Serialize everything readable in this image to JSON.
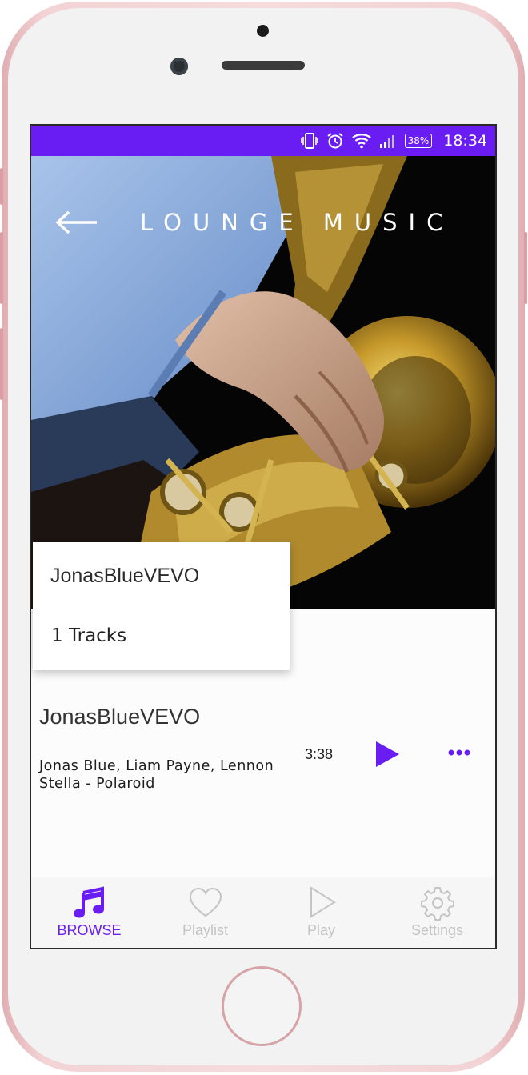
{
  "status_bar": {
    "battery": "38%",
    "time": "18:34",
    "icons": [
      "vibrate-icon",
      "alarm-icon",
      "wifi-icon",
      "signal-icon",
      "battery-icon"
    ]
  },
  "header": {
    "title": "LOUNGE MUSIC",
    "back_icon": "arrow-left-icon"
  },
  "album": {
    "name": "JonasBlueVEVO",
    "tracks_label": "1 Tracks"
  },
  "track": {
    "title": "JonasBlueVEVO",
    "artist": "Jonas Blue, Liam Payne, Lennon Stella - Polaroid",
    "duration": "3:38",
    "play_icon": "play-icon",
    "more_icon": "more-dots-icon"
  },
  "bottom_nav": {
    "items": [
      {
        "label": "BROWSE",
        "icon": "music-note-icon",
        "active": true
      },
      {
        "label": "Playlist",
        "icon": "heart-icon",
        "active": false
      },
      {
        "label": "Play",
        "icon": "play-outline-icon",
        "active": false
      },
      {
        "label": "Settings",
        "icon": "gear-icon",
        "active": false
      }
    ]
  },
  "colors": {
    "accent": "#6a1df2",
    "inactive": "#c4c4c4",
    "frame": "#f3d3d5"
  }
}
